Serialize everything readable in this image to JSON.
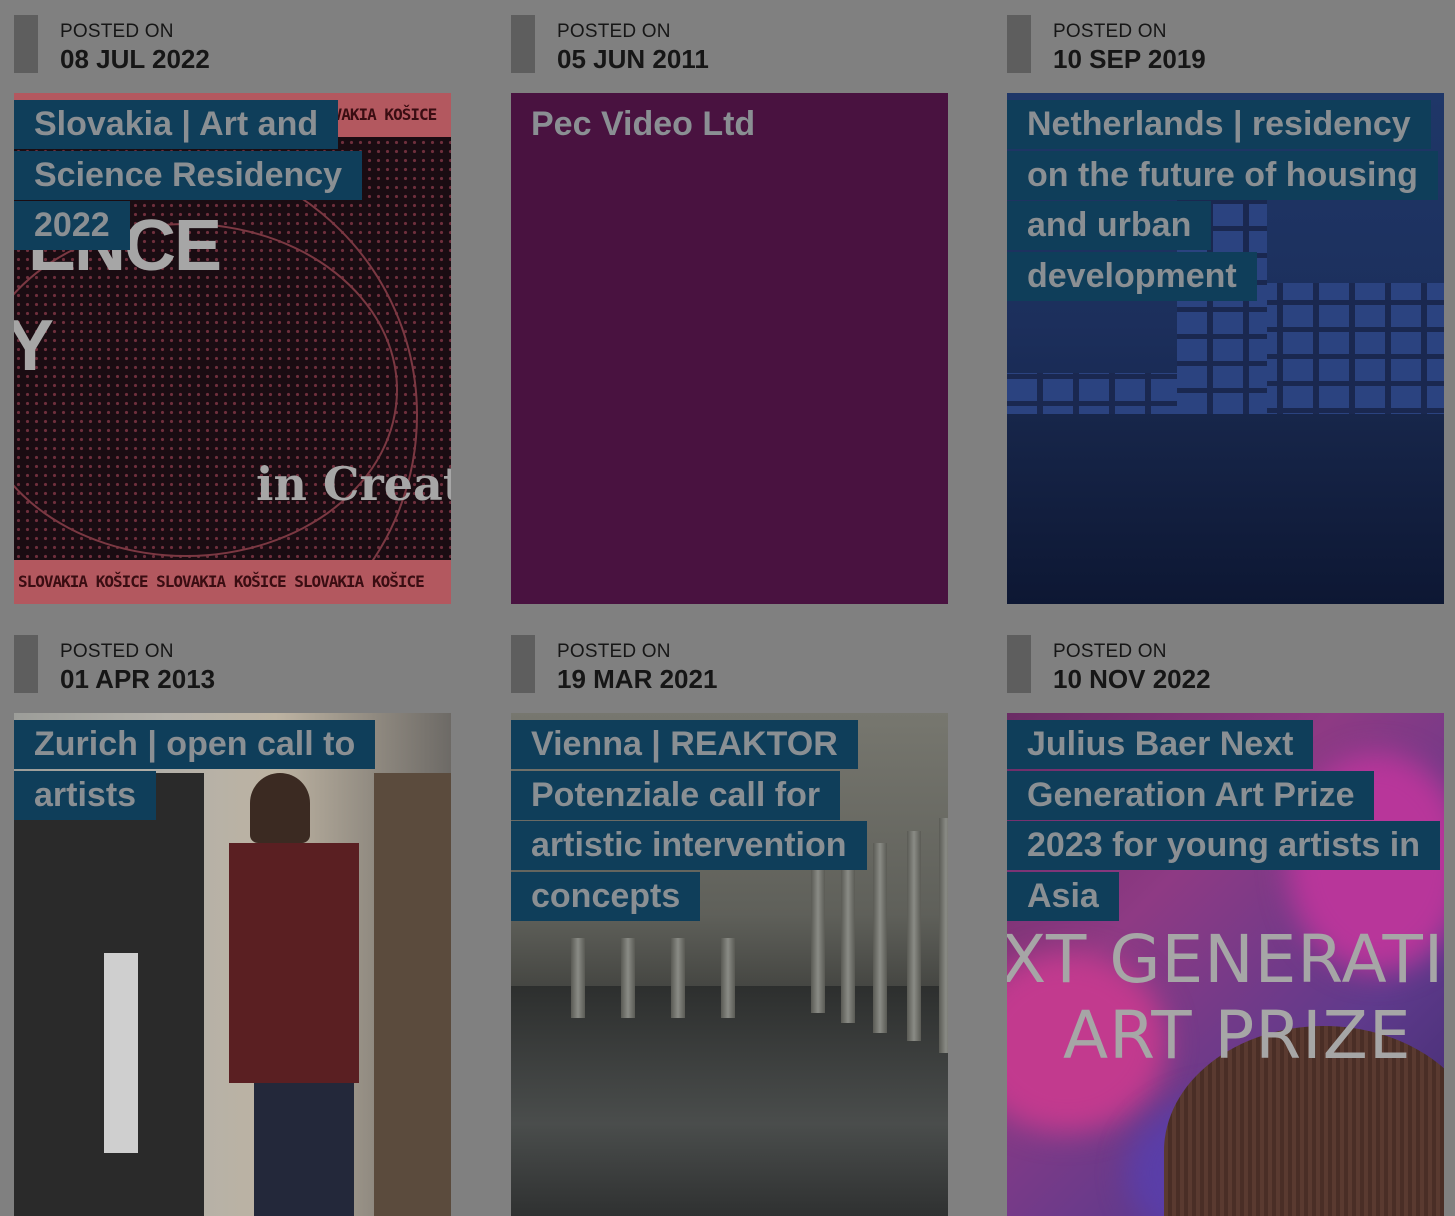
{
  "posts": [
    {
      "posted_label": "POSTED ON",
      "date": "08 JUL 2022",
      "title": "Slovakia | Art and Science Residency 2022",
      "thumbnail": {
        "band_text_top": "OVAKIA  KOŠICE",
        "band_text_bottom": "SLOVAKIA  KOŠICE   SLOVAKIA  KOŠICE   SLOVAKIA  KOŠICE",
        "big_text_1": "ENCE",
        "big_text_2": "Y",
        "script_text": "in Creat"
      }
    },
    {
      "posted_label": "POSTED ON",
      "date": "05 JUN 2011",
      "title": "Pec Video Ltd"
    },
    {
      "posted_label": "POSTED ON",
      "date": "10 SEP 2019",
      "title": "Netherlands | residency on the future of housing and urban development"
    },
    {
      "posted_label": "POSTED ON",
      "date": "01 APR 2013",
      "title": "Zurich | open call to artists"
    },
    {
      "posted_label": "POSTED ON",
      "date": "19 MAR 2021",
      "title": "Vienna | REAKTOR Potenziale call for artistic intervention concepts"
    },
    {
      "posted_label": "POSTED ON",
      "date": "10 NOV 2022",
      "title": "Julius Baer Next Generation Art Prize 2023 for young artists in Asia",
      "thumbnail": {
        "art_text_1": "XT GENERATIC",
        "art_text_2": "ART PRIZE"
      }
    }
  ],
  "colors": {
    "page_background": "#808080",
    "title_highlight": "#0f3e5a",
    "title_text": "#8a8f93",
    "pec_video_tile": "#491240"
  }
}
